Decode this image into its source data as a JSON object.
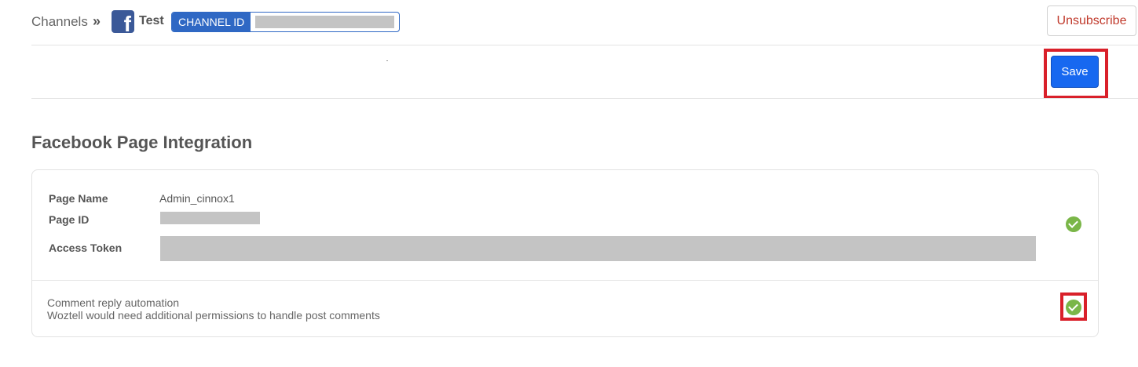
{
  "breadcrumb": {
    "channels_label": "Channels",
    "separator": "»",
    "channel_name": "Test",
    "channel_id_label": "CHANNEL ID"
  },
  "header": {
    "unsubscribe_label": "Unsubscribe"
  },
  "toolbar": {
    "save_label": "Save"
  },
  "section": {
    "title": "Facebook Page Integration"
  },
  "integration": {
    "fields": [
      {
        "label": "Page Name",
        "value": "Admin_cinnox1"
      },
      {
        "label": "Page ID",
        "value": ""
      },
      {
        "label": "Access Token",
        "value": ""
      }
    ],
    "comment_title": "Comment reply automation",
    "comment_description": "Woztell would need additional permissions to handle post comments"
  },
  "colors": {
    "primary": "#1768f0",
    "facebook": "#3b5998",
    "danger": "#c0392b",
    "success": "#7ab648",
    "highlight": "#d9202a"
  },
  "icons": [
    "facebook-logo-icon",
    "check-circle-icon"
  ]
}
